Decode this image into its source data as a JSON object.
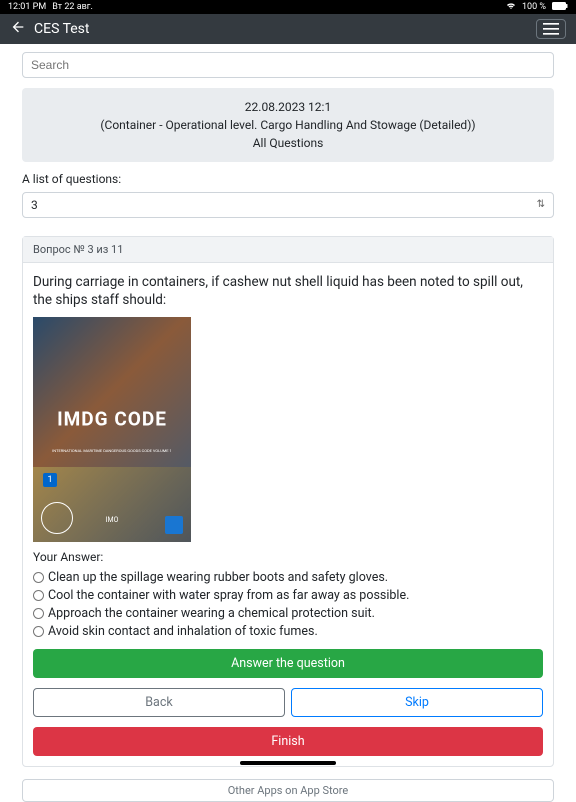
{
  "status": {
    "time": "12:01 PM",
    "date": "Вт 22 авг.",
    "wifi": "wifi-icon",
    "battery_pct": "100 %",
    "battery_icon": "battery-icon"
  },
  "header": {
    "title": "CES Test"
  },
  "search": {
    "placeholder": "Search"
  },
  "info": {
    "datetime": "22.08.2023 12:1",
    "subject": "(Container - Operational level. Cargo Handling And Stowage (Detailed))",
    "mode": "All Questions"
  },
  "list_label": "A list of questions:",
  "selected_question": "3",
  "question": {
    "header": "Вопрос № 3 из 11",
    "text": "During carriage in containers, if cashew nut shell liquid has been noted to spill out, the ships staff should:",
    "image": {
      "title": "IMDG CODE",
      "subtitle": "INTERNATIONAL MARITIME DANGEROUS GOODS CODE VOLUME 1",
      "volume_badge": "1",
      "org": "IMO"
    },
    "your_answer_label": "Your Answer:",
    "options": [
      "Clean up the spillage wearing rubber boots and safety gloves.",
      "Cool the container with water spray from as far away as possible.",
      "Approach the container wearing a chemical protection suit.",
      "Avoid skin contact and inhalation of toxic fumes."
    ]
  },
  "buttons": {
    "answer": "Answer the question",
    "back": "Back",
    "skip": "Skip",
    "finish": "Finish"
  },
  "other_apps": "Other Apps on App Store"
}
